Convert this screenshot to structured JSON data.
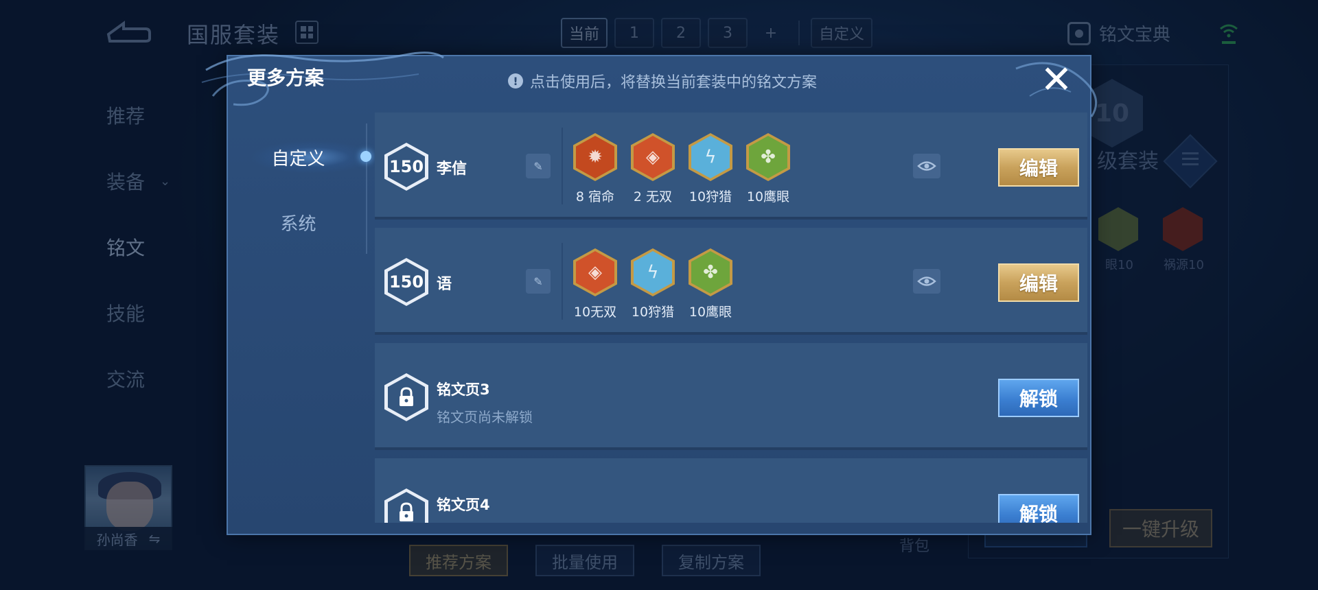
{
  "background": {
    "page_title": "国服套装",
    "top_tabs": [
      "当前",
      "1",
      "2",
      "3",
      "+",
      "自定义"
    ],
    "inscription_book": "铭文宝典",
    "side_nav": [
      {
        "label": "推荐"
      },
      {
        "label": "装备",
        "chevron": "chevron-down-icon"
      },
      {
        "label": "铭文"
      },
      {
        "label": "技能"
      },
      {
        "label": "交流"
      }
    ],
    "hero_name": "孙尚香",
    "bottom_buttons": [
      "推荐方案",
      "批量使用",
      "复制方案"
    ],
    "bag_label": "背包",
    "upgrade_button": "一键升级",
    "right_panel": {
      "level": "10",
      "suit_text": "级套装",
      "rune_labels": [
        "眼10",
        "祸源10"
      ]
    }
  },
  "modal": {
    "title": "更多方案",
    "tip": "点击使用后，将替换当前套装中的铭文方案",
    "close_icon": "close-icon",
    "tabs": [
      "自定义",
      "系统"
    ],
    "active_tab": "自定义",
    "pages": [
      {
        "level": "150",
        "name": "李信",
        "runes": [
          {
            "label": "8 宿命",
            "color": "#c3491f",
            "glyph": "✹"
          },
          {
            "label": "2 无双",
            "color": "#d0522a",
            "glyph": "◈"
          },
          {
            "label": "10狩猎",
            "color": "#5ab0da",
            "glyph": "ϟ"
          },
          {
            "label": "10鹰眼",
            "color": "#6ea53c",
            "glyph": "✤"
          }
        ],
        "action": "编辑"
      },
      {
        "level": "150",
        "name": "语",
        "runes": [
          {
            "label": "10无双",
            "color": "#d0522a",
            "glyph": "◈"
          },
          {
            "label": "10狩猎",
            "color": "#5ab0da",
            "glyph": "ϟ"
          },
          {
            "label": "10鹰眼",
            "color": "#6ea53c",
            "glyph": "✤"
          }
        ],
        "action": "编辑"
      },
      {
        "name": "铭文页3",
        "status": "铭文页尚未解锁",
        "action": "解锁"
      },
      {
        "name": "铭文页4",
        "action": "解锁"
      }
    ]
  },
  "colors": {
    "edit_gold": "#c9a25c",
    "unlock_blue": "#3b7fd1",
    "modal_bg": "#2d4f7c"
  }
}
